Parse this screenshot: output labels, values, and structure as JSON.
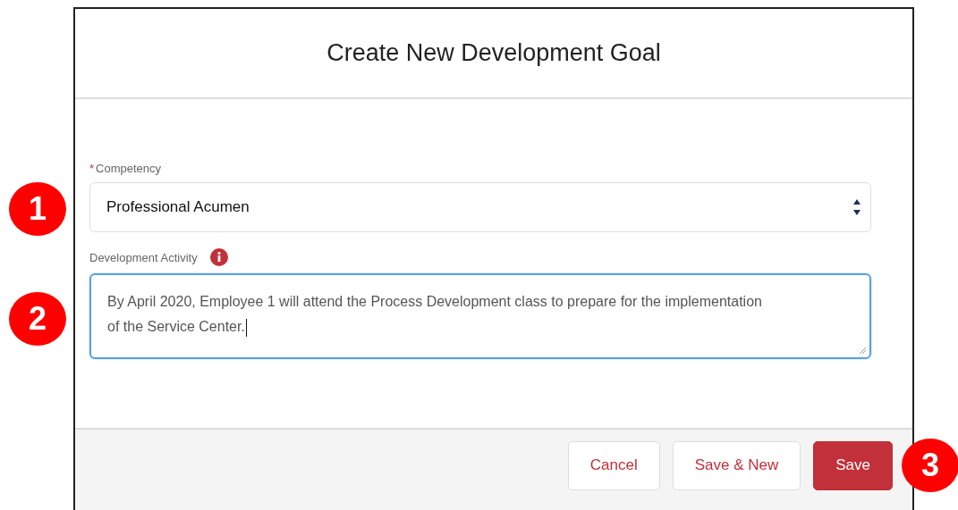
{
  "dialog": {
    "title": "Create New Development Goal"
  },
  "fields": [
    {
      "kind": "select",
      "label": "Competency",
      "required_mark": "*",
      "value": "Professional Acumen",
      "info": false,
      "focused": false
    },
    {
      "kind": "textarea",
      "label": "Development Activity",
      "value": "By April 2020, Employee 1 will attend the Process Development class to prepare for the implementation of the Service Center.",
      "info": true,
      "focused": true
    }
  ],
  "buttons": [
    {
      "label": "Cancel",
      "kind": "neutral"
    },
    {
      "label": "Save & New",
      "kind": "neutral"
    },
    {
      "label": "Save",
      "kind": "brand"
    }
  ],
  "callouts": [
    "1",
    "2",
    "3"
  ]
}
